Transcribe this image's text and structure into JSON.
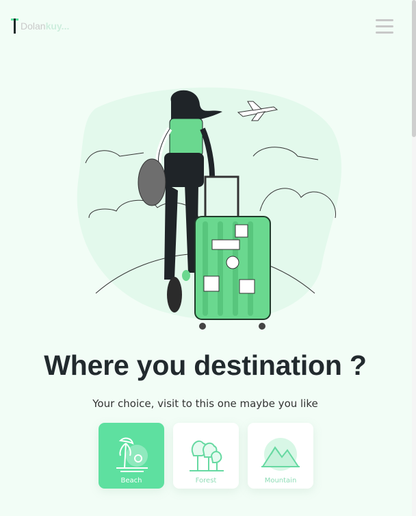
{
  "header": {
    "logo": {
      "name_part1": "Dolan",
      "name_part2": "kuy..."
    }
  },
  "hero": {
    "title": "Where you destination ?",
    "subtitle": "Your choice, visit to this one maybe you like"
  },
  "categories": [
    {
      "label": "Beach",
      "icon": "palm-tree-icon",
      "selected": true
    },
    {
      "label": "Forest",
      "icon": "trees-icon",
      "selected": false
    },
    {
      "label": "Mountain",
      "icon": "mountain-icon",
      "selected": false
    }
  ],
  "colors": {
    "accent": "#5ee0a0",
    "background": "#f2fdf6",
    "title": "#222a2e"
  }
}
